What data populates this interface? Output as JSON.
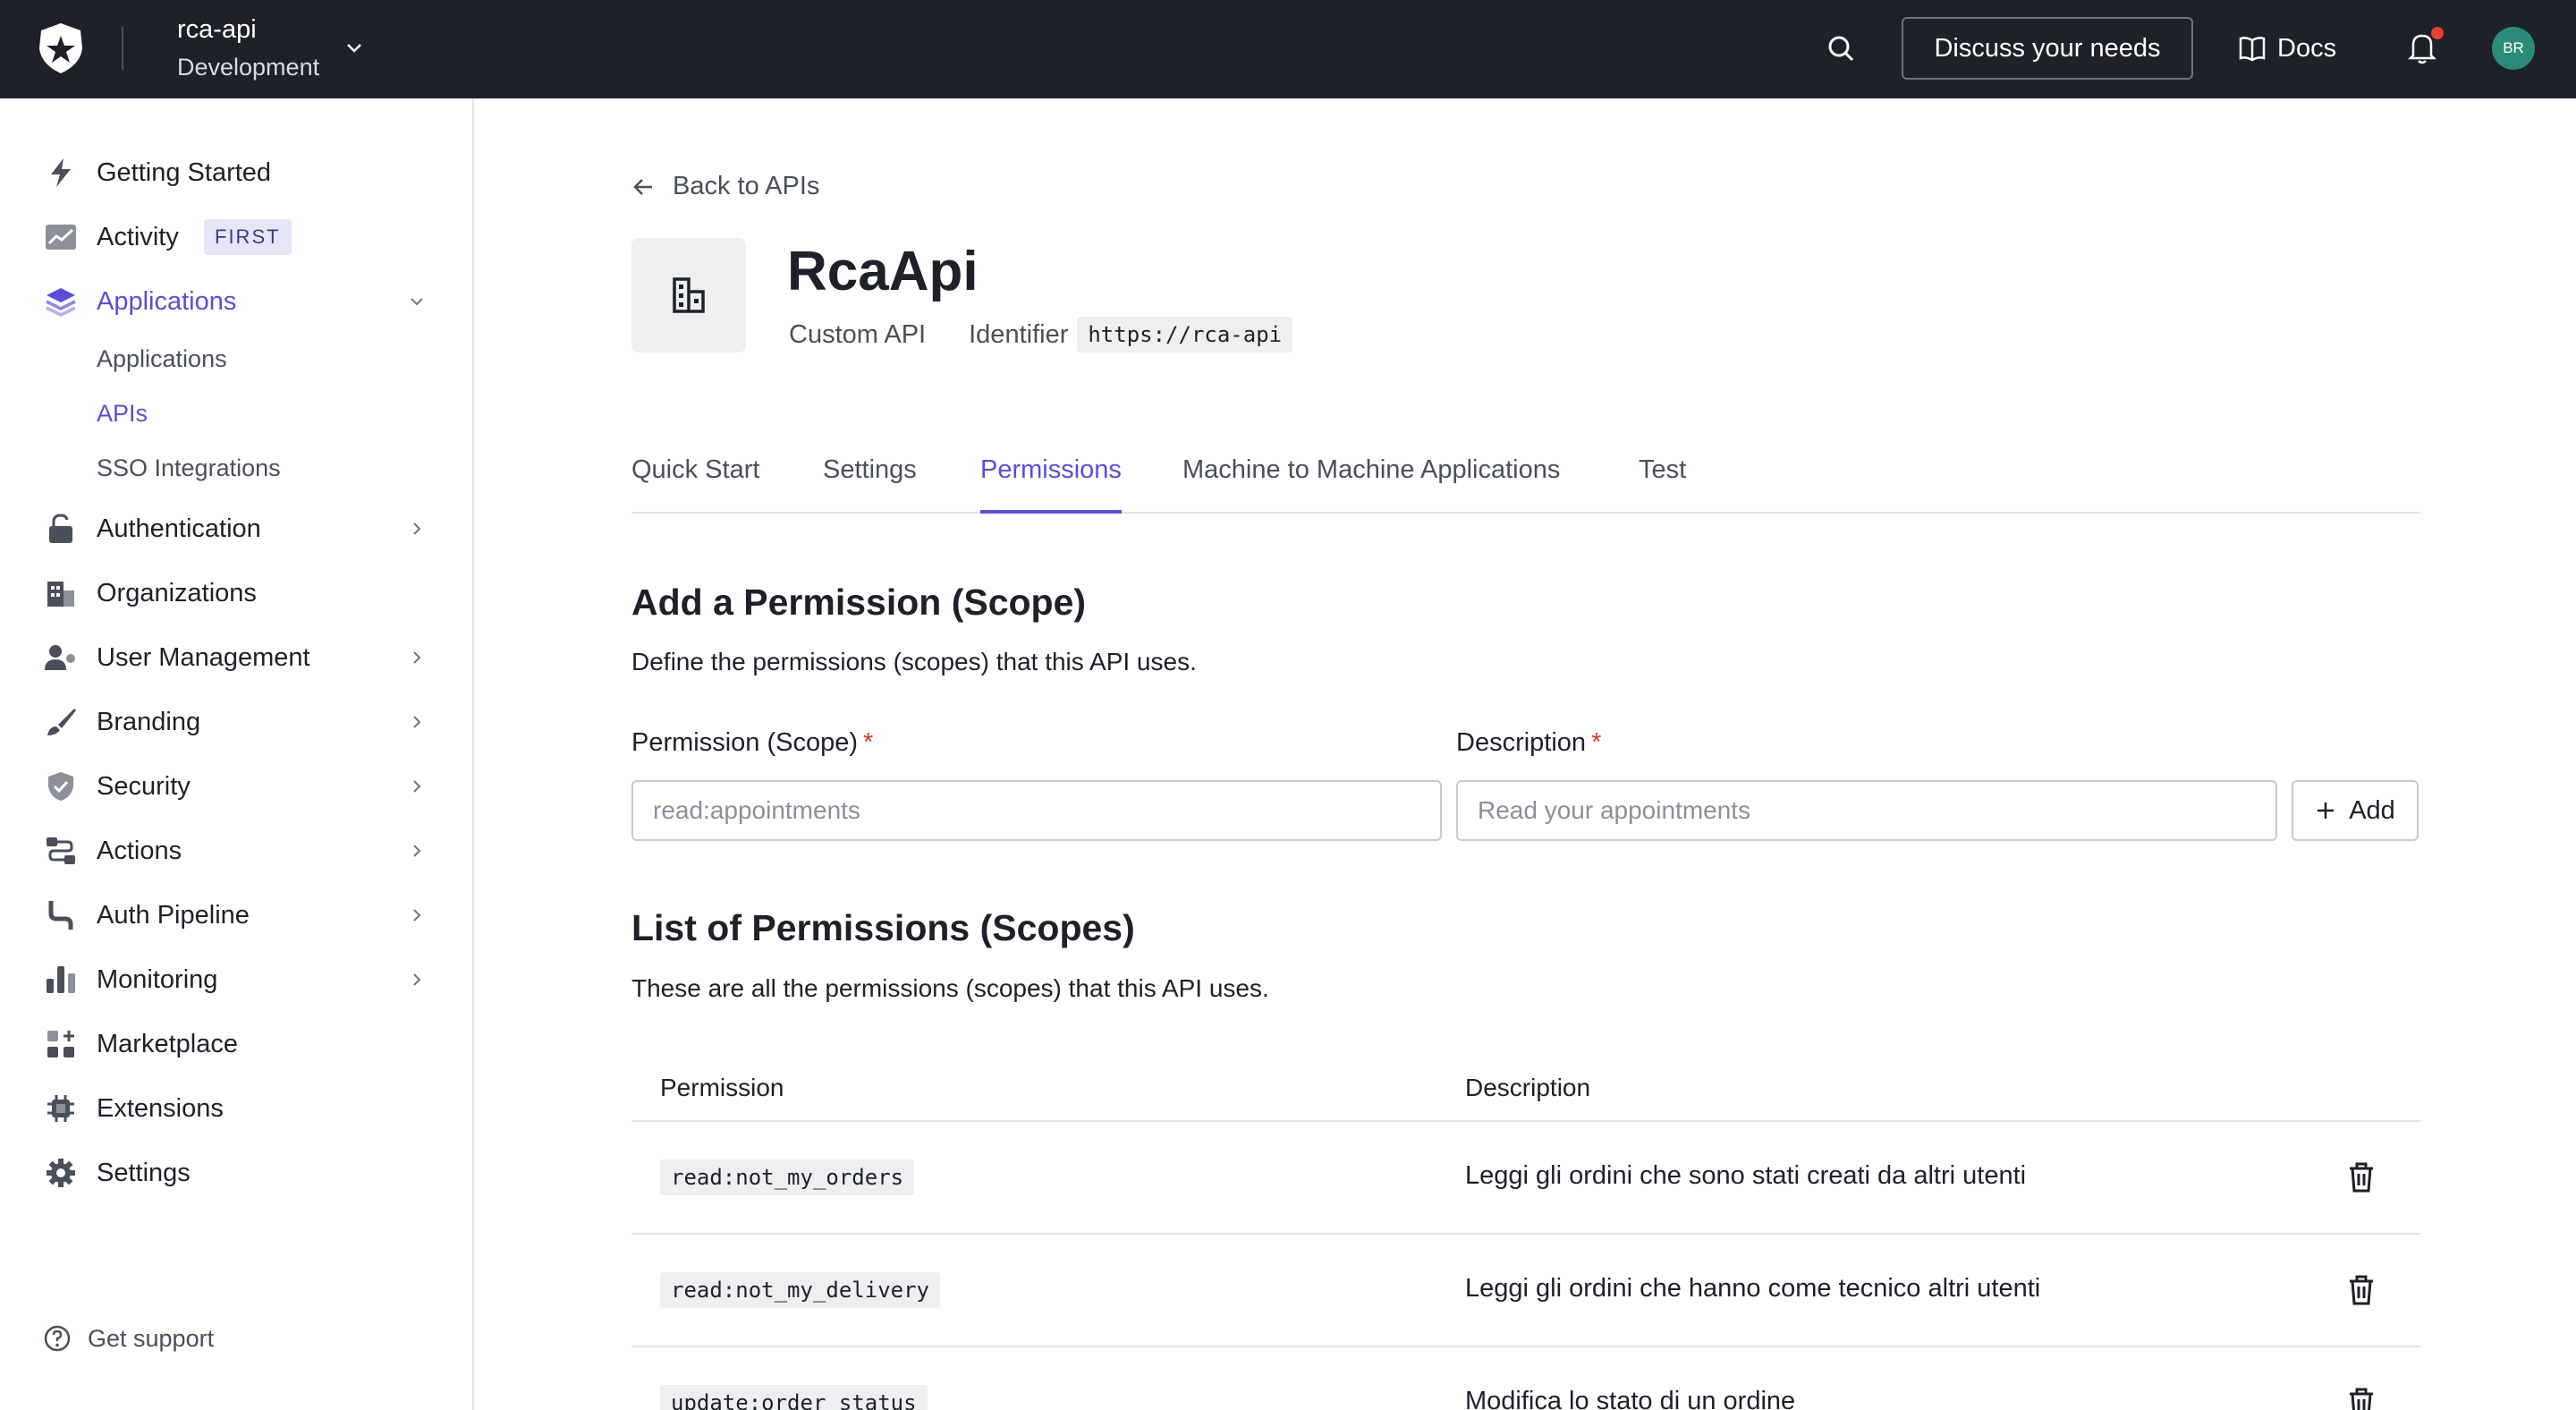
{
  "topbar": {
    "tenant_name": "rca-api",
    "tenant_env": "Development",
    "discuss_label": "Discuss your needs",
    "docs_label": "Docs",
    "avatar_initials": "BR"
  },
  "sidebar": {
    "items": [
      {
        "label": "Getting Started"
      },
      {
        "label": "Activity",
        "badge": "FIRST"
      },
      {
        "label": "Applications"
      },
      {
        "label": "Authentication"
      },
      {
        "label": "Organizations"
      },
      {
        "label": "User Management"
      },
      {
        "label": "Branding"
      },
      {
        "label": "Security"
      },
      {
        "label": "Actions"
      },
      {
        "label": "Auth Pipeline"
      },
      {
        "label": "Monitoring"
      },
      {
        "label": "Marketplace"
      },
      {
        "label": "Extensions"
      },
      {
        "label": "Settings"
      }
    ],
    "sub_items": [
      {
        "label": "Applications"
      },
      {
        "label": "APIs"
      },
      {
        "label": "SSO Integrations"
      }
    ],
    "support_label": "Get support",
    "accent_color": "#5a4fd6"
  },
  "main": {
    "back_label": "Back to APIs",
    "api_title": "RcaApi",
    "api_type": "Custom API",
    "identifier_label": "Identifier",
    "identifier_value": "https://rca-api",
    "tabs": [
      {
        "label": "Quick Start"
      },
      {
        "label": "Settings"
      },
      {
        "label": "Permissions"
      },
      {
        "label": "Machine to Machine Applications"
      },
      {
        "label": "Test"
      }
    ],
    "add_section": {
      "title": "Add a Permission (Scope)",
      "subtitle": "Define the permissions (scopes) that this API uses.",
      "permission_label": "Permission (Scope)",
      "permission_placeholder": "read:appointments",
      "description_label": "Description",
      "description_placeholder": "Read your appointments",
      "required_mark": "*",
      "add_label": "Add"
    },
    "list_section": {
      "title": "List of Permissions (Scopes)",
      "subtitle": "These are all the permissions (scopes) that this API uses.",
      "col_permission": "Permission",
      "col_description": "Description",
      "rows": [
        {
          "permission": "read:not_my_orders",
          "description": "Leggi gli ordini che sono stati creati da altri utenti"
        },
        {
          "permission": "read:not_my_delivery",
          "description": "Leggi gli ordini che hanno come tecnico altri utenti"
        },
        {
          "permission": "update:order_status",
          "description": "Modifica lo stato di un ordine"
        }
      ]
    }
  }
}
